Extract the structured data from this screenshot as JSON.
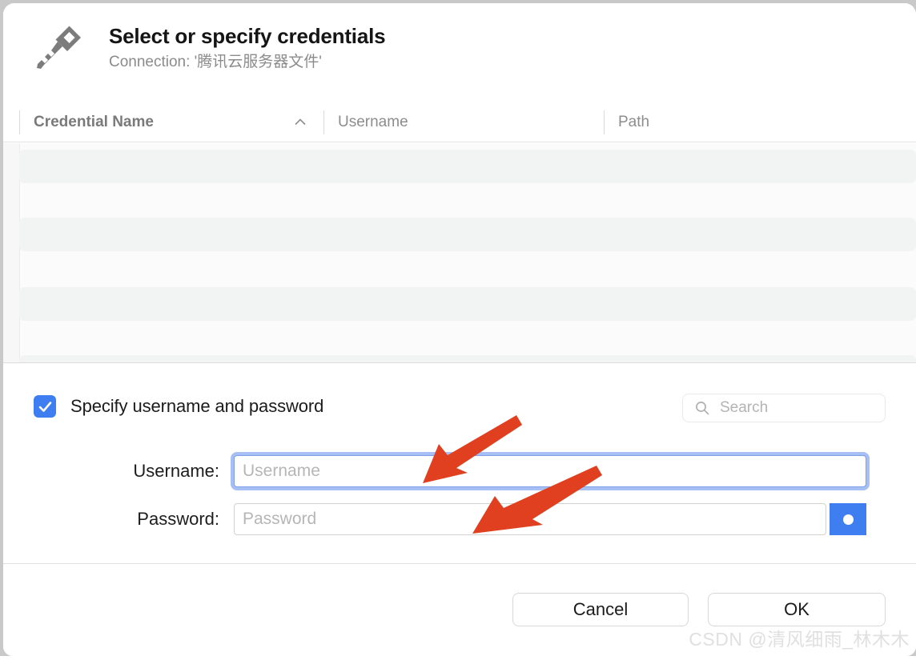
{
  "dialog": {
    "title": "Select or specify credentials",
    "subtitle": "Connection: '腾讯云服务器文件'",
    "icon": "key-icon"
  },
  "table": {
    "columns": [
      {
        "label": "Credential Name",
        "sorted": true,
        "sort_direction": "ascending",
        "sort_icon": "chevron-up-icon"
      },
      {
        "label": "Username"
      },
      {
        "label": "Path"
      }
    ],
    "rows": []
  },
  "options": {
    "specify_credentials": {
      "label": "Specify username and password",
      "checked": true,
      "check_icon": "checkmark-icon"
    },
    "search": {
      "placeholder": "Search",
      "value": "",
      "icon": "search-icon"
    }
  },
  "credentials": {
    "username": {
      "label": "Username:",
      "placeholder": "Username",
      "value": "",
      "focused": true
    },
    "password": {
      "label": "Password:",
      "placeholder": "Password",
      "value": "",
      "reveal_icon": "dot-icon"
    }
  },
  "footer": {
    "cancel_label": "Cancel",
    "ok_label": "OK"
  },
  "watermark": {
    "text": "CSDN @清风细雨_林木木"
  },
  "colors": {
    "accent_blue": "#3f7ef0",
    "focus_ring": "#a6bff4",
    "annotation_red": "#e0401f",
    "stripe_gray": "#f2f4f4",
    "muted_text": "#8d8d8d"
  },
  "annotations": {
    "arrows": [
      {
        "name": "arrow-to-username-field",
        "color": "#e0401f"
      },
      {
        "name": "arrow-to-password-field",
        "color": "#e0401f"
      }
    ]
  }
}
